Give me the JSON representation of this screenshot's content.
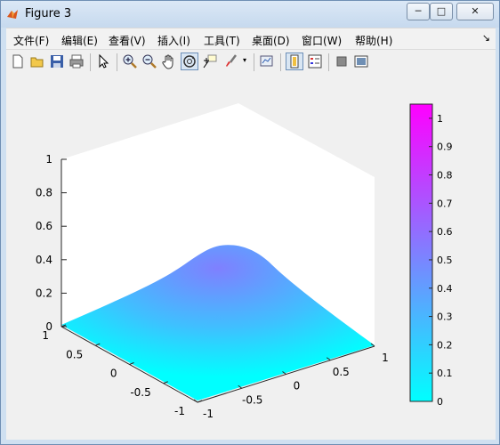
{
  "window": {
    "title": "Figure 3",
    "min_label": "─",
    "max_label": "□",
    "close_label": "✕"
  },
  "menu": [
    {
      "label": "文件(F)"
    },
    {
      "label": "编辑(E)"
    },
    {
      "label": "查看(V)"
    },
    {
      "label": "插入(I)"
    },
    {
      "label": "工具(T)"
    },
    {
      "label": "桌面(D)"
    },
    {
      "label": "窗口(W)"
    },
    {
      "label": "帮助(H)"
    }
  ],
  "menu_overflow": "↘",
  "toolbar": [
    "new-figure-icon",
    "open-file-icon",
    "save-icon",
    "print-icon",
    "pointer-icon",
    "zoom-in-icon",
    "zoom-out-icon",
    "pan-hand-icon",
    "rotate-3d-icon",
    "data-cursor-icon",
    "brush-icon",
    "link-plot-icon",
    "colorbar-toggle-icon",
    "legend-toggle-icon",
    "hide-plot-tools-icon",
    "show-plot-tools-icon"
  ],
  "colors": {
    "colormap_low": "#00ffff",
    "colormap_high": "#ff00ff",
    "figure_bg": "#f0f0f0"
  },
  "chart_data": {
    "type": "surface",
    "title": "",
    "xlabel": "",
    "ylabel": "",
    "zlabel": "",
    "xlim": [
      -1,
      1
    ],
    "ylim": [
      -1,
      1
    ],
    "zlim": [
      0,
      1
    ],
    "x_ticks": [
      "-1",
      "-0.5",
      "0",
      "0.5",
      "1"
    ],
    "y_ticks": [
      "-1",
      "-0.5",
      "0",
      "0.5",
      "1"
    ],
    "z_ticks": [
      "0",
      "0.2",
      "0.4",
      "0.6",
      "0.8",
      "1"
    ],
    "surface": "smooth peak centered at (0,0), maximum ≈0.5, falling to 0 at edges",
    "peak_value": 0.5,
    "colormap": "cool",
    "colorbar": {
      "min": 0,
      "max": 1.05,
      "ticks": [
        "0",
        "0.1",
        "0.2",
        "0.3",
        "0.4",
        "0.5",
        "0.6",
        "0.7",
        "0.8",
        "0.9",
        "1"
      ]
    },
    "grid": false
  }
}
